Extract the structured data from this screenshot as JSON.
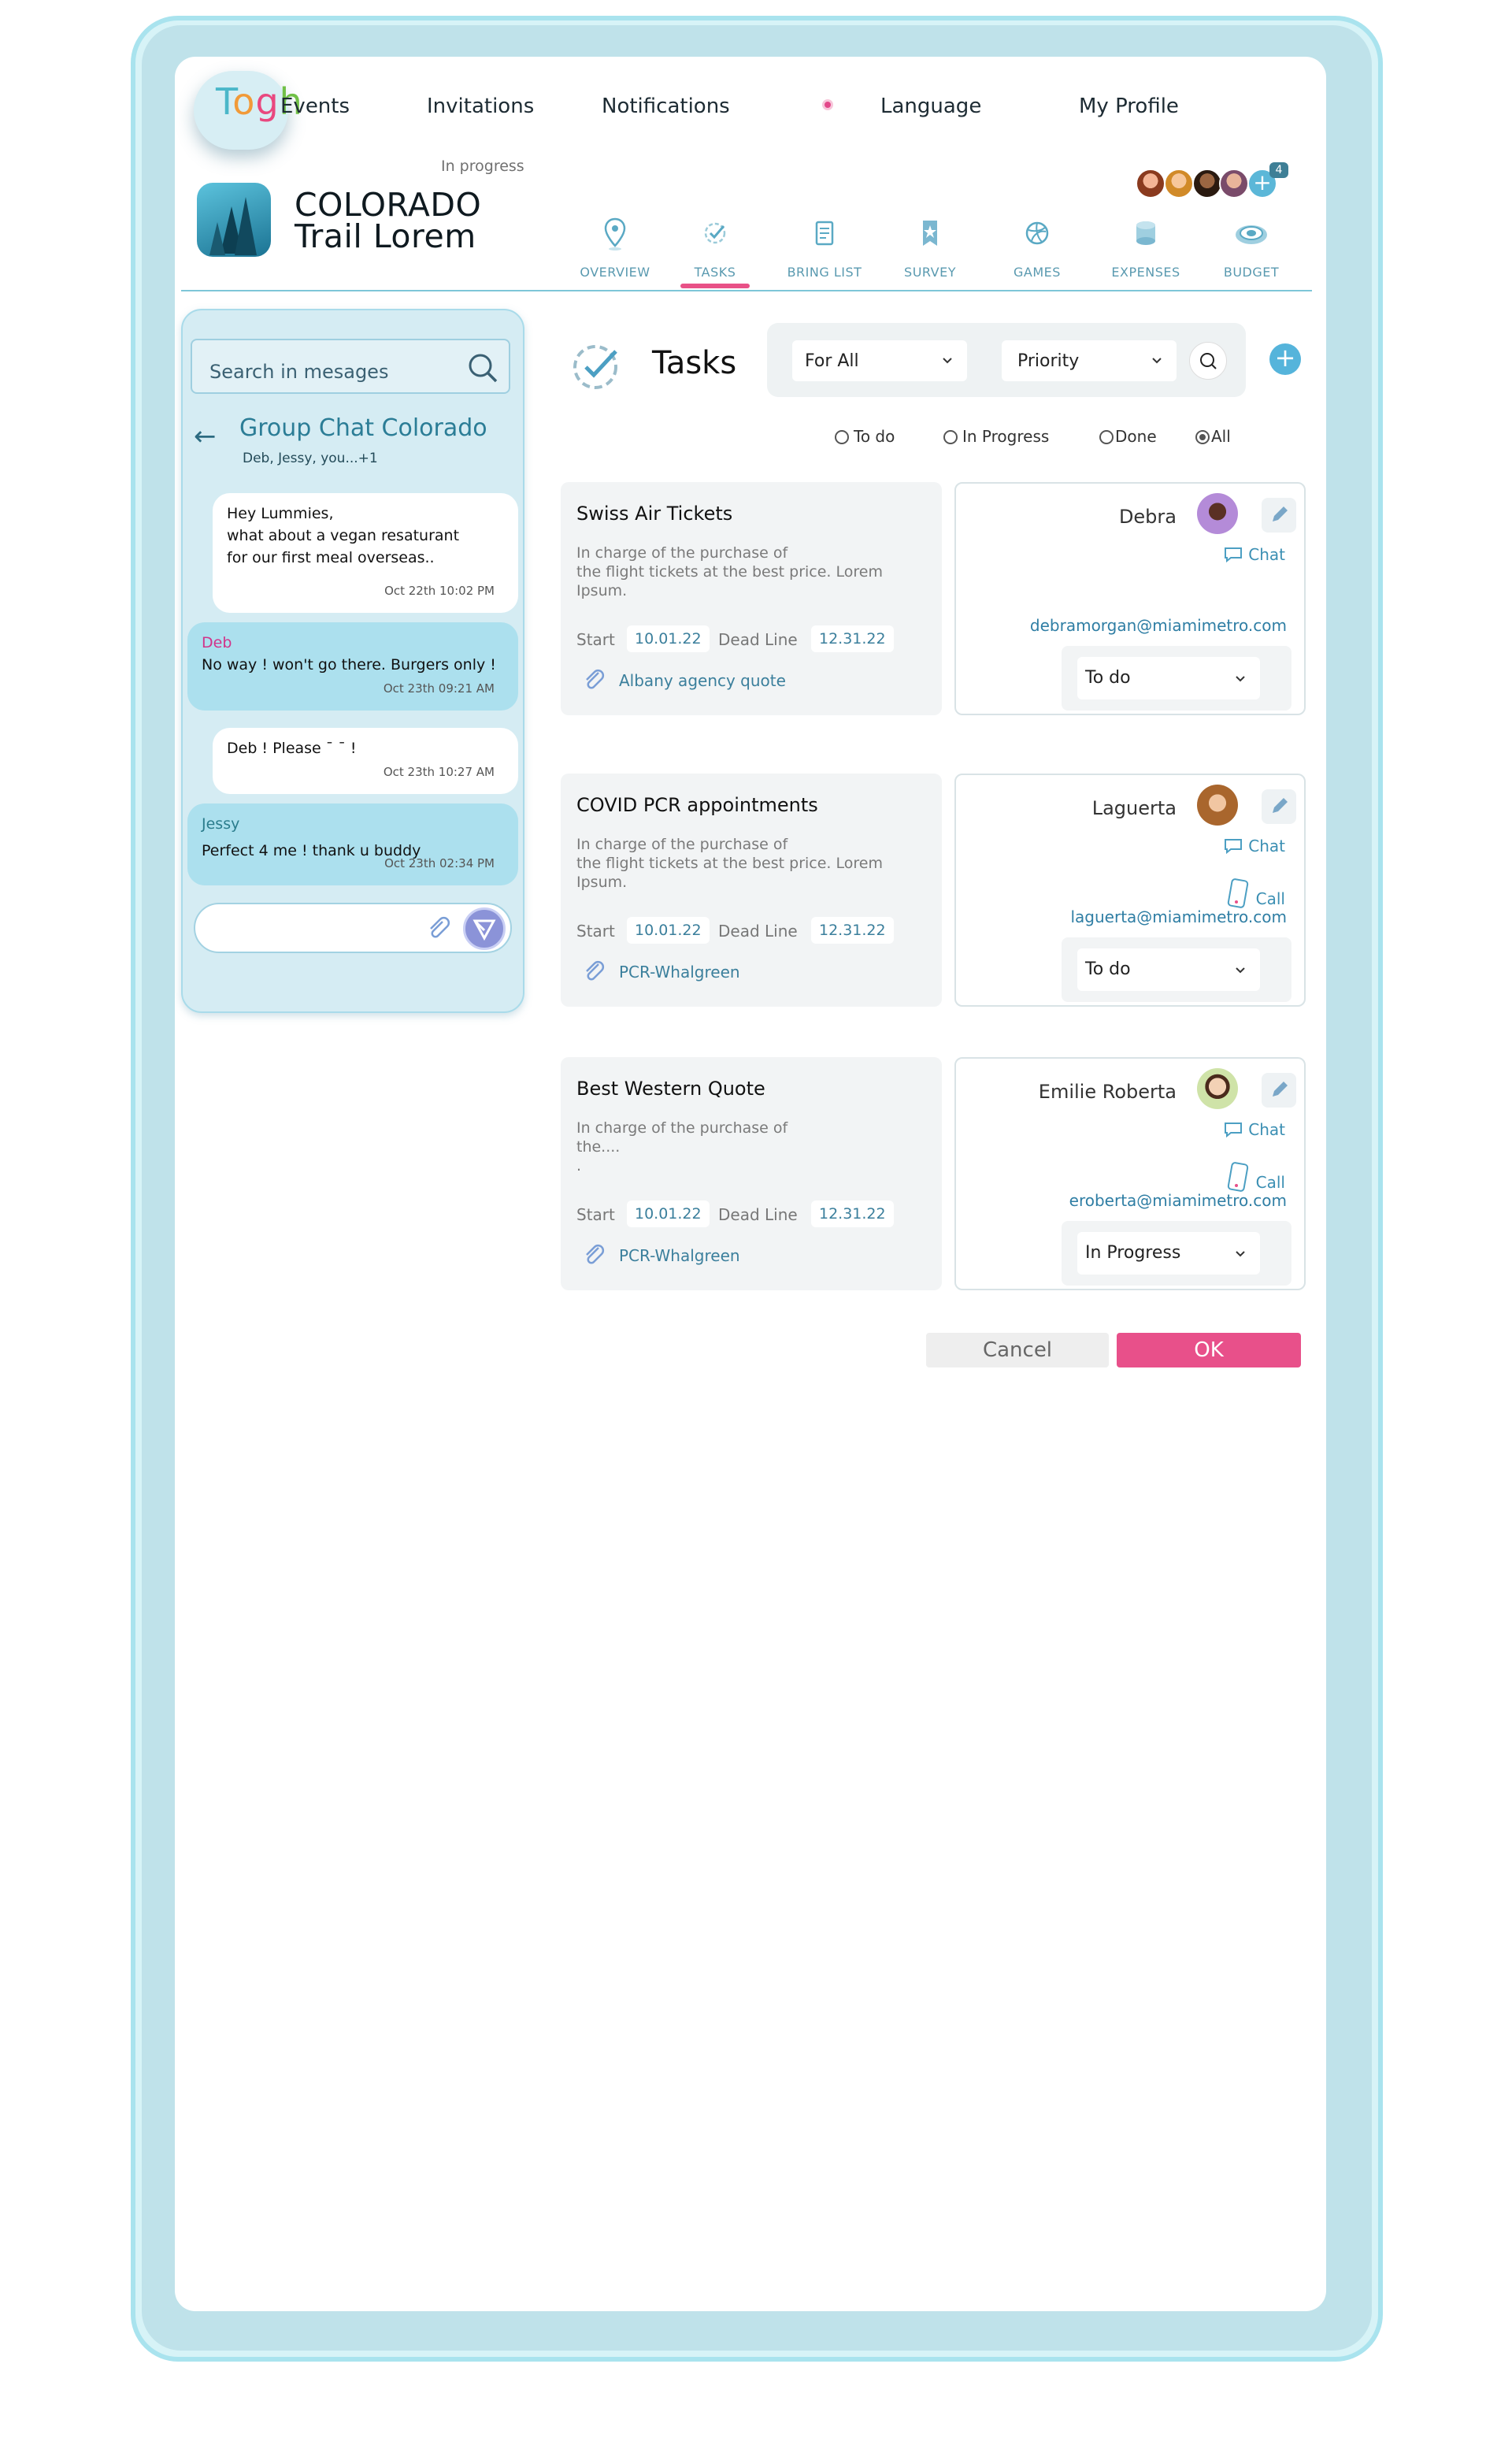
{
  "app": {
    "logo_letters": [
      "T",
      "o",
      "g",
      "h"
    ],
    "nav": [
      "Events",
      "Invitations",
      "Notifications",
      "Language",
      "My Profile"
    ]
  },
  "trip": {
    "status": "In progress",
    "title_line1": "COLORADO",
    "title_line2": "Trail Lorem",
    "extra_members": "4"
  },
  "tabs": [
    {
      "label": "OVERVIEW",
      "icon": "map-pin-icon"
    },
    {
      "label": "TASKS",
      "icon": "tasks-check-icon",
      "active": true
    },
    {
      "label": "BRING LIST",
      "icon": "list-icon"
    },
    {
      "label": "SURVEY",
      "icon": "survey-star-icon"
    },
    {
      "label": "GAMES",
      "icon": "ball-icon"
    },
    {
      "label": "EXPENSES",
      "icon": "coins-icon"
    },
    {
      "label": "BUDGET",
      "icon": "budget-icon"
    }
  ],
  "chat": {
    "search_placeholder": "Search in mesages",
    "name": "Group Chat Colorado",
    "members": "Deb, Jessy, you...+1",
    "messages": [
      {
        "sender": "",
        "text_lines": [
          "Hey Lummies,",
          "what about a vegan resaturant",
          "for our first meal overseas.."
        ],
        "time": "Oct 22th 10:02 PM",
        "style": "white"
      },
      {
        "sender": "Deb",
        "text_lines": [
          "No way !  won't go there. Burgers only !"
        ],
        "time": "Oct 23th 09:21 AM",
        "style": "blue"
      },
      {
        "sender": "",
        "text_lines": [
          "Deb ! Please ¯ ¯ !"
        ],
        "time": "Oct 23th 10:27 AM",
        "style": "white"
      },
      {
        "sender": "Jessy",
        "text_lines": [
          "Perfect 4 me ! thank u buddy"
        ],
        "time": "Oct 23th 02:34 PM",
        "style": "blue"
      }
    ]
  },
  "tasks": {
    "title": "Tasks",
    "filter_assignee": "For All",
    "filter_sort": "Priority",
    "status_filters": [
      "To do",
      "In Progress",
      "Done",
      "All"
    ],
    "selected_filter": "All",
    "start_label": "Start",
    "deadline_label": "Dead Line",
    "chat_label": "Chat",
    "call_label": "Call",
    "items": [
      {
        "title": "Swiss Air Tickets",
        "description": "In charge of the purchase of\n the flight tickets at the best price. Lorem\nIpsum.",
        "start": "10.01.22",
        "deadline": "12.31.22",
        "attachment": "Albany agency quote",
        "assignee": "Debra",
        "email": "debramorgan@miamimetro.com",
        "status": "To do",
        "has_call": false
      },
      {
        "title": "COVID PCR appointments",
        "description": "In charge of the purchase of\n the flight tickets at the best price. Lorem\nIpsum.",
        "start": "10.01.22",
        "deadline": "12.31.22",
        "attachment": "PCR-Whalgreen",
        "assignee": "Laguerta",
        "email": "laguerta@miamimetro.com",
        "status": "To do",
        "has_call": true
      },
      {
        "title": "Best Western Quote",
        "description": "In charge of the purchase of\n the....\n.",
        "start": "10.01.22",
        "deadline": "12.31.22",
        "attachment": "PCR-Whalgreen",
        "assignee": "Emilie Roberta",
        "email": "eroberta@miamimetro.com",
        "status": "In Progress",
        "has_call": true
      }
    ]
  },
  "actions": {
    "cancel": "Cancel",
    "ok": "OK"
  },
  "colors": {
    "accent_pink": "#e8508a",
    "accent_blue": "#55b4db",
    "frame": "#bfe2ea"
  }
}
